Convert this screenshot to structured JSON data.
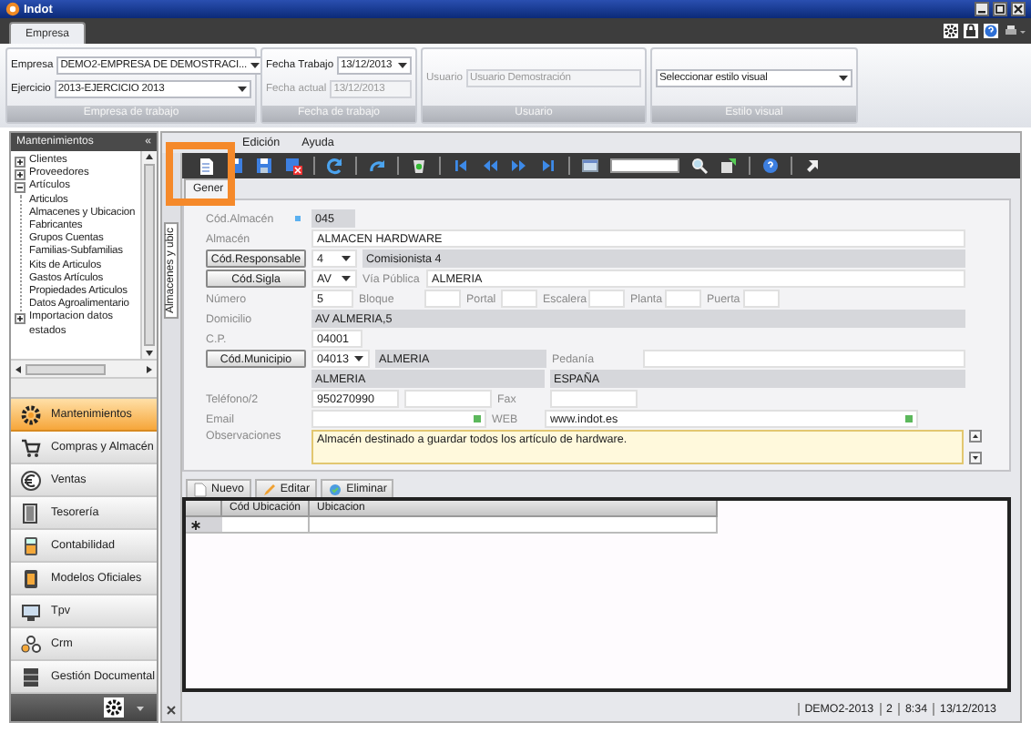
{
  "window": {
    "title": "Indot"
  },
  "ribbon": {
    "tabs": [
      {
        "label": "Empresa",
        "selected": true
      }
    ],
    "groups": [
      {
        "caption": "Empresa de trabajo",
        "fields": [
          {
            "label": "Empresa",
            "value": "DEMO2-EMPRESA DE DEMOSTRACI...",
            "kind": "combo",
            "disabled": false
          },
          {
            "label": "Ejercicio",
            "value": "2013-EJERCICIO 2013",
            "kind": "combo",
            "disabled": false
          }
        ]
      },
      {
        "caption": "Fecha de trabajo",
        "fields": [
          {
            "label": "Fecha Trabajo",
            "value": "13/12/2013",
            "kind": "combo",
            "disabled": false
          },
          {
            "label": "Fecha actual",
            "value": "13/12/2013",
            "kind": "text",
            "disabled": true
          }
        ]
      },
      {
        "caption": "Usuario",
        "fields": [
          {
            "label": "Usuario",
            "value": "Usuario Demostración",
            "kind": "text",
            "disabled": true
          }
        ]
      },
      {
        "caption": "Estilo visual",
        "fields": [
          {
            "value": "Seleccionar estilo visual",
            "kind": "combo",
            "disabled": false
          }
        ]
      }
    ]
  },
  "sidebar": {
    "title": "Mantenimientos",
    "collapse_glyph": "«",
    "tree": [
      {
        "label": "Clientes",
        "expanded": false
      },
      {
        "label": "Proveedores",
        "expanded": false
      },
      {
        "label": "Artículos",
        "expanded": true,
        "children": [
          {
            "label": "Articulos"
          },
          {
            "label": "Almacenes y Ubicacion"
          },
          {
            "label": "Fabricantes"
          },
          {
            "label": "Grupos Cuentas"
          },
          {
            "label": "Familias-Subfamilias"
          },
          {
            "label": "Kits de Articulos"
          },
          {
            "label": "Gastos Artículos"
          },
          {
            "label": "Propiedades Articulos"
          },
          {
            "label": "Datos Agroalimentario"
          }
        ]
      },
      {
        "label": "Importacion datos estados",
        "expanded": false
      }
    ],
    "nav": [
      {
        "label": "Mantenimientos",
        "selected": true
      },
      {
        "label": "Compras y Almacén",
        "selected": false
      },
      {
        "label": "Ventas",
        "selected": false
      },
      {
        "label": "Tesorería",
        "selected": false
      },
      {
        "label": "Contabilidad",
        "selected": false
      },
      {
        "label": "Modelos Oficiales",
        "selected": false
      },
      {
        "label": "Tpv",
        "selected": false
      },
      {
        "label": "Crm",
        "selected": false
      },
      {
        "label": "Gestión Documental",
        "selected": false
      }
    ]
  },
  "main": {
    "menu": [
      "Edición",
      "Ayuda"
    ],
    "side_tab": "Almacenes y ubic",
    "form": {
      "tabs": [
        {
          "label": "Gener",
          "selected": true
        }
      ],
      "rows": [
        {
          "items": [
            {
              "kind": "label",
              "text": "Cód.Almacén"
            },
            {
              "kind": "key"
            },
            {
              "kind": "display",
              "value": "045"
            }
          ]
        },
        {
          "items": [
            {
              "kind": "label",
              "text": "Almacén"
            },
            {
              "kind": "text",
              "value": "ALMACEN HARDWARE"
            }
          ]
        },
        {
          "items": [
            {
              "kind": "button",
              "text": "Cód.Responsable"
            },
            {
              "kind": "combo",
              "value": "4"
            },
            {
              "kind": "display",
              "value": "Comisionista 4"
            }
          ]
        },
        {
          "items": [
            {
              "kind": "button",
              "text": "Cód.Sigla"
            },
            {
              "kind": "combo",
              "value": "AV"
            },
            {
              "kind": "label",
              "text": "Vía Pública"
            },
            {
              "kind": "text",
              "value": "ALMERIA"
            }
          ]
        },
        {
          "items": [
            {
              "kind": "label",
              "text": "Número"
            },
            {
              "kind": "text",
              "value": "5"
            },
            {
              "kind": "label",
              "text": "Bloque"
            },
            {
              "kind": "text"
            },
            {
              "kind": "label",
              "text": "Portal"
            },
            {
              "kind": "text"
            },
            {
              "kind": "label",
              "text": "Escalera"
            },
            {
              "kind": "text"
            },
            {
              "kind": "label",
              "text": "Planta"
            },
            {
              "kind": "text"
            },
            {
              "kind": "label",
              "text": "Puerta"
            },
            {
              "kind": "text"
            }
          ]
        },
        {
          "items": [
            {
              "kind": "label",
              "text": "Domicilio"
            },
            {
              "kind": "display",
              "value": "AV ALMERIA,5"
            }
          ]
        },
        {
          "items": [
            {
              "kind": "label",
              "text": "C.P."
            },
            {
              "kind": "text",
              "value": "04001"
            }
          ]
        },
        {
          "items": [
            {
              "kind": "button",
              "text": "Cód.Municipio"
            },
            {
              "kind": "combo",
              "value": "04013"
            },
            {
              "kind": "display",
              "value": "ALMERIA"
            },
            {
              "kind": "label",
              "text": "Pedanía"
            },
            {
              "kind": "text"
            }
          ]
        },
        {
          "items": [
            {
              "kind": "display",
              "value": "ALMERIA"
            },
            {
              "kind": "display",
              "value": "ESPAÑA"
            }
          ]
        },
        {
          "items": [
            {
              "kind": "label",
              "text": "Teléfono/2"
            },
            {
              "kind": "text",
              "value": "950270990"
            },
            {
              "kind": "text"
            },
            {
              "kind": "label",
              "text": "Fax"
            },
            {
              "kind": "text"
            }
          ]
        },
        {
          "items": [
            {
              "kind": "label",
              "text": "Email"
            },
            {
              "kind": "linkfield"
            },
            {
              "kind": "label",
              "text": "WEB"
            },
            {
              "kind": "linkfield",
              "value": "www.indot.es"
            }
          ]
        },
        {
          "items": [
            {
              "kind": "label",
              "text": "Observaciones"
            },
            {
              "kind": "memo",
              "value": "Almacén destinado a guardar todos los artículo de hardware."
            }
          ]
        }
      ]
    },
    "grid_toolbar": [
      "Nuevo",
      "Editar",
      "Eliminar"
    ],
    "grid": {
      "columns": [
        "Cód Ubicación",
        "Ubicacion"
      ]
    },
    "status_bar": [
      "DEMO2-2013",
      "2",
      "8:34",
      "13/12/2013"
    ]
  }
}
